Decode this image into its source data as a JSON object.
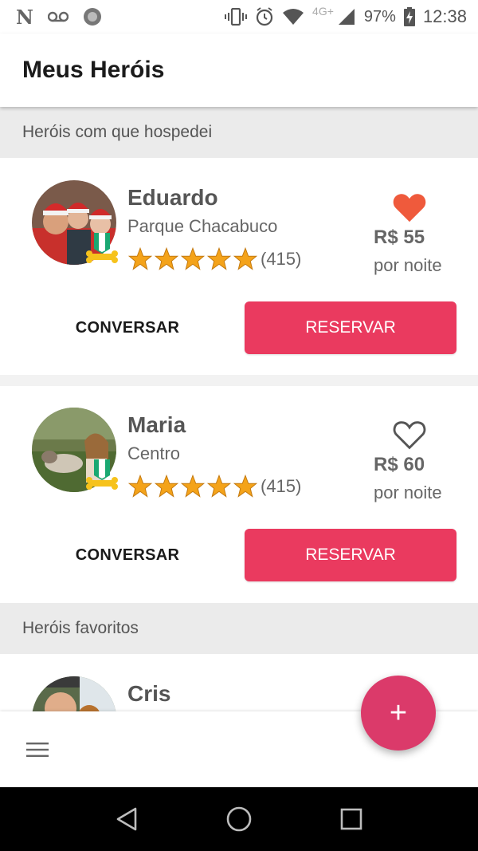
{
  "status_bar": {
    "network_label": "4G+",
    "battery": "97%",
    "time": "12:38",
    "n_badge": "N"
  },
  "app_bar": {
    "title": "Meus Heróis"
  },
  "sections": {
    "hosted": "Heróis com que hospedei",
    "favorites": "Heróis favoritos"
  },
  "cards": [
    {
      "name": "Eduardo",
      "place": "Parque Chacabuco",
      "rating_count": "(415)",
      "price": "R$ 55",
      "per_night": "por noite",
      "favorite": true,
      "chat_label": "CONVERSAR",
      "book_label": "RESERVAR"
    },
    {
      "name": "Maria",
      "place": "Centro",
      "rating_count": "(415)",
      "price": "R$ 60",
      "per_night": "por noite",
      "favorite": false,
      "chat_label": "CONVERSAR",
      "book_label": "RESERVAR"
    },
    {
      "name": "Cris"
    }
  ],
  "rating_stars": 5,
  "fab": {
    "label": "+"
  },
  "colors": {
    "accent": "#ea3a5f",
    "heart": "#ef5a3c",
    "star": "#f4a31a",
    "fab": "#db3a6a"
  },
  "icons": {
    "menu": "hamburger-menu-icon",
    "heart_filled": "heart-filled-icon",
    "heart_outline": "heart-outline-icon",
    "star": "star-icon",
    "badge": "medal-bone-icon"
  }
}
